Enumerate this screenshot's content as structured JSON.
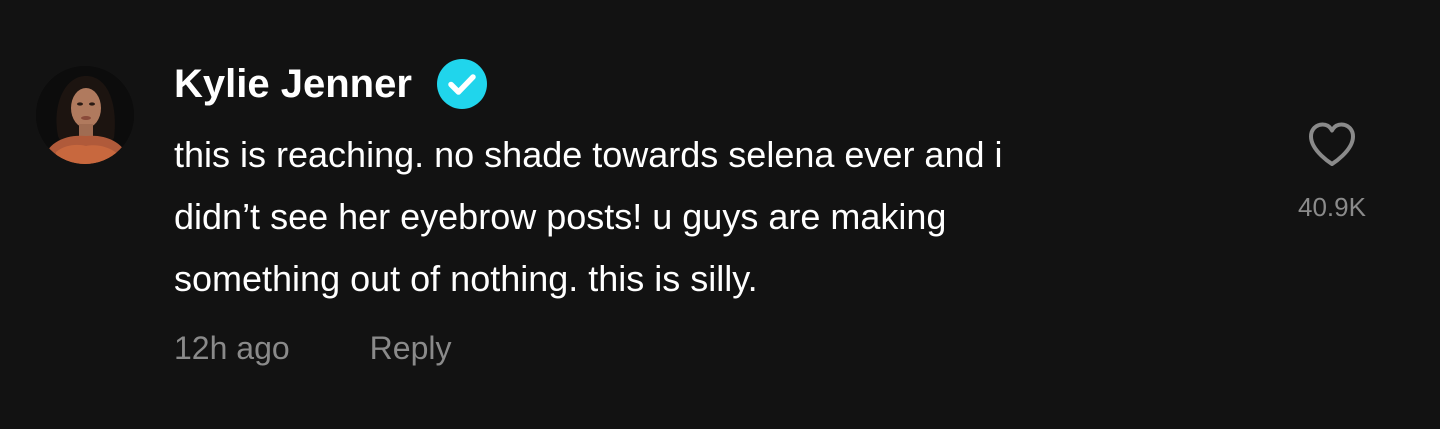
{
  "comment": {
    "author": "Kylie Jenner",
    "verified": true,
    "text_lines": [
      "this is reaching. no shade towards selena ever and i",
      "didn’t see her eyebrow posts! u guys are making",
      "something out of nothing. this is silly."
    ],
    "timestamp": "12h ago",
    "reply_label": "Reply",
    "like_count": "40.9K",
    "avatar_icon": "profile-photo",
    "like_icon": "heart-outline-icon",
    "verified_icon": "verified-badge-icon"
  },
  "colors": {
    "background": "#121212",
    "primary_text": "#ffffff",
    "secondary_text": "#8a8a8a",
    "verified_badge": "#20d5ec"
  }
}
